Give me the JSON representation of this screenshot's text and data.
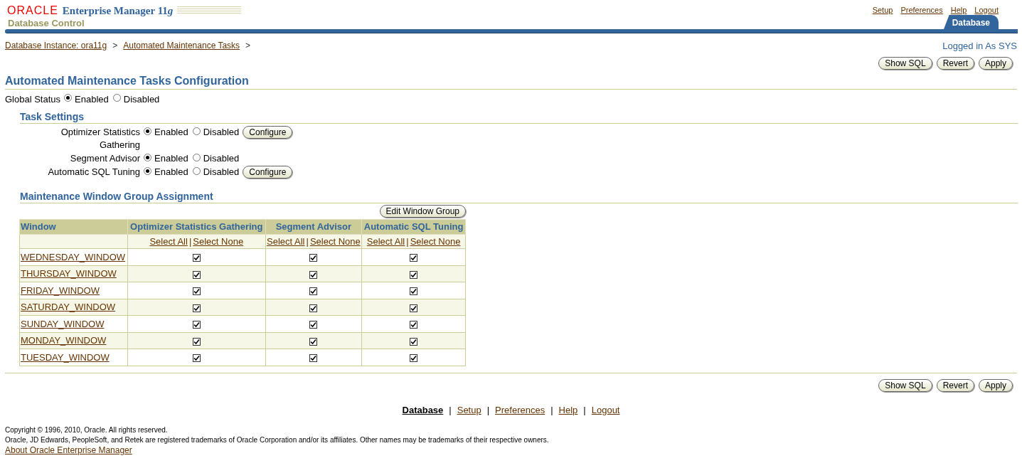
{
  "header": {
    "logo": "ORACLE",
    "product": "Enterprise Manager 11",
    "product_suffix": "g",
    "subtitle": "Database Control",
    "global_links": [
      "Setup",
      "Preferences",
      "Help",
      "Logout"
    ],
    "tabs": [
      {
        "label": "Database",
        "selected": true
      }
    ]
  },
  "breadcrumb": {
    "items": [
      "Database Instance: ora11g",
      "Automated Maintenance Tasks"
    ],
    "separator": ">"
  },
  "login_status": "Logged in As SYS",
  "top_buttons": [
    "Show SQL",
    "Revert",
    "Apply"
  ],
  "page_title": "Automated Maintenance Tasks Configuration",
  "global_status": {
    "label": "Global Status",
    "options": [
      {
        "label": "Enabled",
        "selected": true
      },
      {
        "label": "Disabled",
        "selected": false
      }
    ]
  },
  "task_settings": {
    "title": "Task Settings",
    "tasks": [
      {
        "label": "Optimizer Statistics Gathering",
        "options": [
          {
            "label": "Enabled",
            "selected": true
          },
          {
            "label": "Disabled",
            "selected": false
          }
        ],
        "button": "Configure"
      },
      {
        "label": "Segment Advisor",
        "options": [
          {
            "label": "Enabled",
            "selected": true
          },
          {
            "label": "Disabled",
            "selected": false
          }
        ]
      },
      {
        "label": "Automatic SQL Tuning",
        "options": [
          {
            "label": "Enabled",
            "selected": true
          },
          {
            "label": "Disabled",
            "selected": false
          }
        ],
        "button": "Configure"
      }
    ]
  },
  "window_group": {
    "title": "Maintenance Window Group Assignment",
    "button": "Edit Window Group",
    "first_column": "Window",
    "link_separator": "|",
    "columns": [
      {
        "label": "Optimizer Statistics Gathering",
        "select_all": "Select All",
        "select_none": "Select None"
      },
      {
        "label": "Segment Advisor",
        "select_all": "Select All",
        "select_none": "Select None"
      },
      {
        "label": "Automatic SQL Tuning",
        "select_all": "Select All",
        "select_none": "Select None"
      }
    ],
    "rows": [
      {
        "window": "WEDNESDAY_WINDOW",
        "checked": [
          true,
          true,
          true
        ]
      },
      {
        "window": "THURSDAY_WINDOW",
        "checked": [
          true,
          true,
          true
        ]
      },
      {
        "window": "FRIDAY_WINDOW",
        "checked": [
          true,
          true,
          true
        ]
      },
      {
        "window": "SATURDAY_WINDOW",
        "checked": [
          true,
          true,
          true
        ]
      },
      {
        "window": "SUNDAY_WINDOW",
        "checked": [
          true,
          true,
          true
        ]
      },
      {
        "window": "MONDAY_WINDOW",
        "checked": [
          true,
          true,
          true
        ]
      },
      {
        "window": "TUESDAY_WINDOW",
        "checked": [
          true,
          true,
          true
        ]
      }
    ]
  },
  "bottom_buttons": [
    "Show SQL",
    "Revert",
    "Apply"
  ],
  "footer": {
    "separator": "|",
    "links": [
      {
        "label": "Database",
        "selected": true
      },
      {
        "label": "Setup",
        "selected": false
      },
      {
        "label": "Preferences",
        "selected": false
      },
      {
        "label": "Help",
        "selected": false
      },
      {
        "label": "Logout",
        "selected": false
      }
    ],
    "copyright": "Copyright © 1996, 2010, Oracle. All rights reserved.",
    "trademark": "Oracle, JD Edwards, PeopleSoft, and Retek are registered trademarks of Oracle Corporation and/or its affiliates. Other names may be trademarks of their respective owners.",
    "about": "About Oracle Enterprise Manager"
  }
}
